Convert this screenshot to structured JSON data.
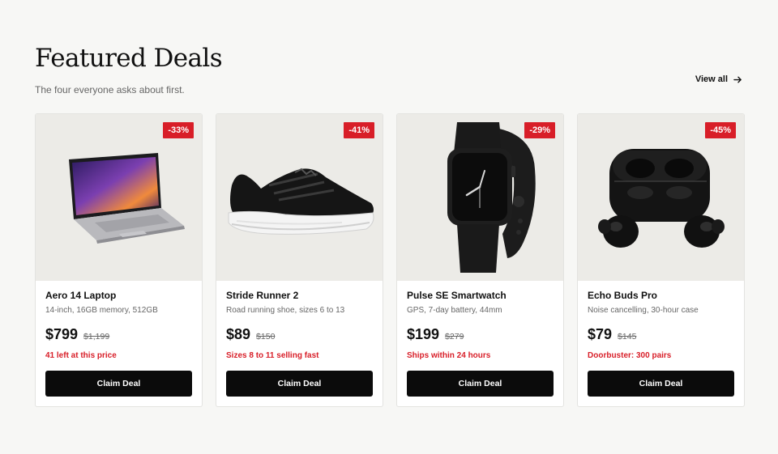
{
  "header": {
    "title": "Featured Deals",
    "subtitle": "The four everyone asks about first.",
    "view_all": "View all"
  },
  "products": [
    {
      "badge": "-33%",
      "name": "Aero 14 Laptop",
      "desc": "14-inch, 16GB memory, 512GB",
      "price": "$799",
      "old_price": "$1,199",
      "note": "41 left at this price",
      "cta": "Claim Deal",
      "icon": "laptop-image"
    },
    {
      "badge": "-41%",
      "name": "Stride Runner 2",
      "desc": "Road running shoe, sizes 6 to 13",
      "price": "$89",
      "old_price": "$150",
      "note": "Sizes 8 to 11 selling fast",
      "cta": "Claim Deal",
      "icon": "running-shoe-image"
    },
    {
      "badge": "-29%",
      "name": "Pulse SE Smartwatch",
      "desc": "GPS, 7-day battery, 44mm",
      "price": "$199",
      "old_price": "$279",
      "note": "Ships within 24 hours",
      "cta": "Claim Deal",
      "icon": "smartwatch-image"
    },
    {
      "badge": "-45%",
      "name": "Echo Buds Pro",
      "desc": "Noise cancelling, 30-hour case",
      "price": "$79",
      "old_price": "$145",
      "note": "Doorbuster: 300 pairs",
      "cta": "Claim Deal",
      "icon": "earbuds-image"
    }
  ],
  "colors": {
    "accent": "#d81e28",
    "button": "#0b0b0b",
    "background": "#f7f7f5"
  }
}
